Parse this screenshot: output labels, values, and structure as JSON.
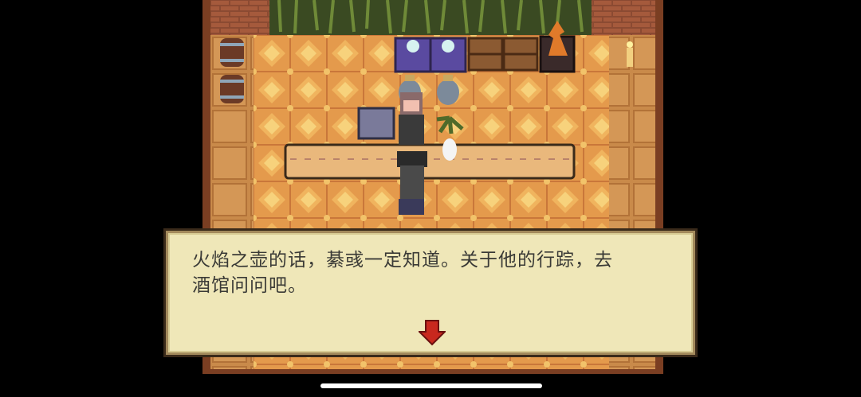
{
  "dialog": {
    "text": "火焰之壶的话，綦彧一定知道。关于他的行踪，去\n酒馆问问吧。",
    "next_icon": "red-down-arrow-icon"
  },
  "colors": {
    "floor_tile": "#e49a4c",
    "floor_diamond": "#f2c36a",
    "wall_brick": "#8b4a32",
    "counter": "#e9b87c",
    "dialog_bg": "#efe7b8",
    "arrow": "#c8281e"
  }
}
